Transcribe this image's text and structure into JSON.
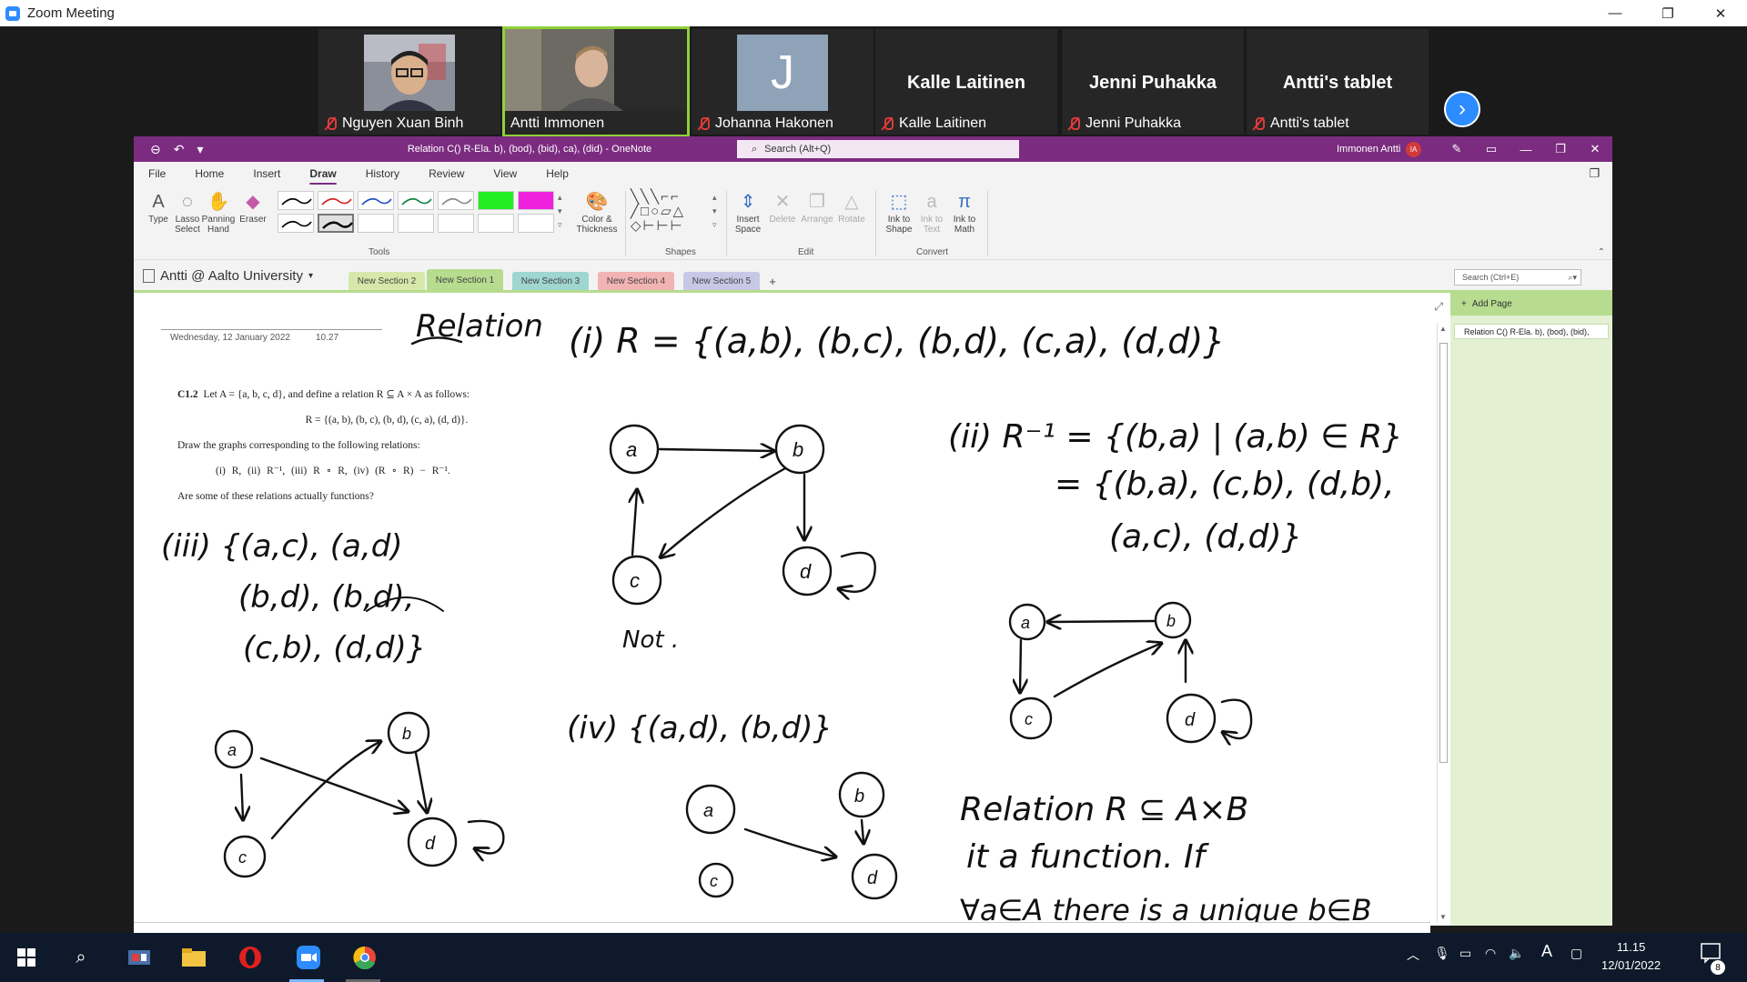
{
  "zoom": {
    "title": "Zoom Meeting",
    "window_controls": [
      "—",
      "❐",
      "✕"
    ]
  },
  "participants": [
    {
      "name": "Nguyen Xuan Binh",
      "type": "video",
      "muted": true
    },
    {
      "name": "Antti Immonen",
      "type": "video",
      "muted": false,
      "active": true
    },
    {
      "name": "Johanna Hakonen",
      "type": "avatar",
      "initial": "J",
      "muted": true
    },
    {
      "name": "Kalle Laitinen",
      "type": "name",
      "muted": true
    },
    {
      "name": "Jenni Puhakka",
      "type": "name",
      "muted": true
    },
    {
      "name": "Antti's tablet",
      "type": "name",
      "muted": true
    }
  ],
  "onenote": {
    "doc_title": "Relation C() R-Ela. b), (bod), (bid), ca), (did)  -  OneNote",
    "search_placeholder": "Search (Alt+Q)",
    "user": "Immonen Antti",
    "user_initials": "IA",
    "menu": [
      "File",
      "Home",
      "Insert",
      "Draw",
      "History",
      "Review",
      "View",
      "Help"
    ],
    "selected_menu": "Draw",
    "ribbon": {
      "type": "Type",
      "lasso": "Lasso Select",
      "panning": "Panning Hand",
      "eraser": "Eraser",
      "color_thickness": "Color & Thickness",
      "insert_space": "Insert Space",
      "delete": "Delete",
      "arrange": "Arrange",
      "rotate": "Rotate",
      "ink_to_shape": "Ink to Shape",
      "ink_to_text": "Ink to Text",
      "ink_to_math": "Ink to Math",
      "groups": [
        "Tools",
        "Shapes",
        "Edit",
        "Convert"
      ]
    },
    "notebook": "Antti @ Aalto University",
    "sections": [
      {
        "label": "New Section 2",
        "color": "#d5e8a9"
      },
      {
        "label": "New Section 1",
        "color": "#b7dc8f",
        "active": true
      },
      {
        "label": "New Section 3",
        "color": "#9fd6d0"
      },
      {
        "label": "New Section 4",
        "color": "#f2b3b3"
      },
      {
        "label": "New Section 5",
        "color": "#c8c8e6"
      }
    ],
    "add_section": "+",
    "page_search": "Search (Ctrl+E)",
    "add_page": "Add Page",
    "page_item": "Relation C() R-Ela. b), (bod), (bid),",
    "page_date": "Wednesday, 12 January 2022",
    "page_time": "10.27",
    "problem": {
      "heading": "C1.2",
      "intro": "Let A = {a, b, c, d}, and define a relation R ⊆ A × A as follows:",
      "relation": "R = {(a, b), (b, c), (b, d), (c, a), (d, d)}.",
      "task": "Draw the graphs corresponding to the following relations:",
      "items": "(i)  R,      (ii)  R⁻¹,      (iii)  R ∘ R,      (iv)  (R ∘ R) − R⁻¹.",
      "question": "Are some of these relations actually functions?"
    }
  },
  "taskbar": {
    "time": "11.15",
    "date": "12/01/2022",
    "notifications": "8"
  }
}
